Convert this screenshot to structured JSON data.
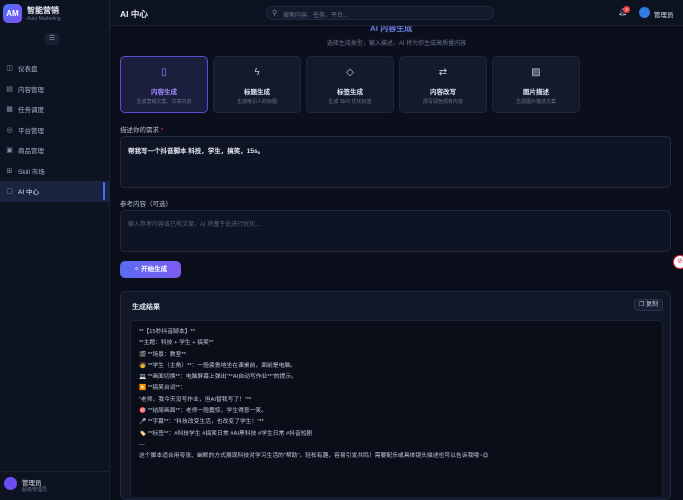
{
  "brand": {
    "logo": "AM",
    "name": "智能营销",
    "sub": "Auto Marketing"
  },
  "sidebar": {
    "collapse_icon": "menu-icon",
    "items": [
      {
        "label": "仪表盘",
        "icon": "◫"
      },
      {
        "label": "内容管理",
        "icon": "▤"
      },
      {
        "label": "任务调度",
        "icon": "▦"
      },
      {
        "label": "平台管理",
        "icon": "◎"
      },
      {
        "label": "商品管理",
        "icon": "▣"
      },
      {
        "label": "Skill 市场",
        "icon": "⊞"
      },
      {
        "label": "AI 中心",
        "icon": "▢",
        "active": true
      }
    ],
    "user": {
      "name": "管理员",
      "role": "超级管理员"
    }
  },
  "topbar": {
    "title": "AI 中心",
    "search_placeholder": "搜索内容、任务、平台...",
    "notifications": "3",
    "user": "管理员"
  },
  "hero": {
    "title": "AI 内容生成",
    "subtitle": "选择生成类型，输入描述，AI 将为你生成高质量内容"
  },
  "cards": [
    {
      "title": "内容生成",
      "desc": "生成营销文案、文章内容",
      "icon": "▯",
      "selected": true
    },
    {
      "title": "标题生成",
      "desc": "生成吸引人的标题",
      "icon": "ϟ"
    },
    {
      "title": "标签生成",
      "desc": "生成 SEO 优化标签",
      "icon": "◇"
    },
    {
      "title": "内容改写",
      "desc": "改写润色现有内容",
      "icon": "⇄"
    },
    {
      "title": "图片描述",
      "desc": "生成图片描述文案",
      "icon": "▨"
    }
  ],
  "form": {
    "desc_label": "描述你的需求",
    "desc_required": "*",
    "desc_value": "帮我写一个抖音脚本  科技，学生，搞笑，15s。",
    "ref_label": "参考内容（可选）",
    "ref_placeholder": "输入参考内容或已有文案，AI 将基于此进行优化...",
    "generate_label": "开始生成"
  },
  "result": {
    "title": "生成结果",
    "copy_label": "复制",
    "lines": [
      "**【15秒抖音脚本】**",
      "**主题：科技 + 学生 + 搞笑**",
      "🎬 **场景：教室**",
      "🧑 **学生（主角）**：一脸疲惫地坐在课桌前，面前是电脑。",
      "💻 **画面切换**：电脑屏幕上弹出“**AI自动写作业**”的提示。",
      "▶️ **搞笑台词**：",
      "“老师，我今天没写作业，但AI替我写了！”**",
      "🎯 **结尾画面**：老师一脸震惊，学生得意一笑。",
      "🎤 **字幕**：“科技改变生活，也改变了学生！”**",
      "🏷️ **标签**：#科技学生 #搞笑日常 #AI黑科技 #学生日常 #抖音短剧",
      "---",
      "这个脚本适合用夸张、幽默的方式展现科技对学习生活的“帮助”，轻松有趣，容易引发共鸣！需要配乐或具体镜头描述也可以告诉我哦~😊"
    ]
  }
}
